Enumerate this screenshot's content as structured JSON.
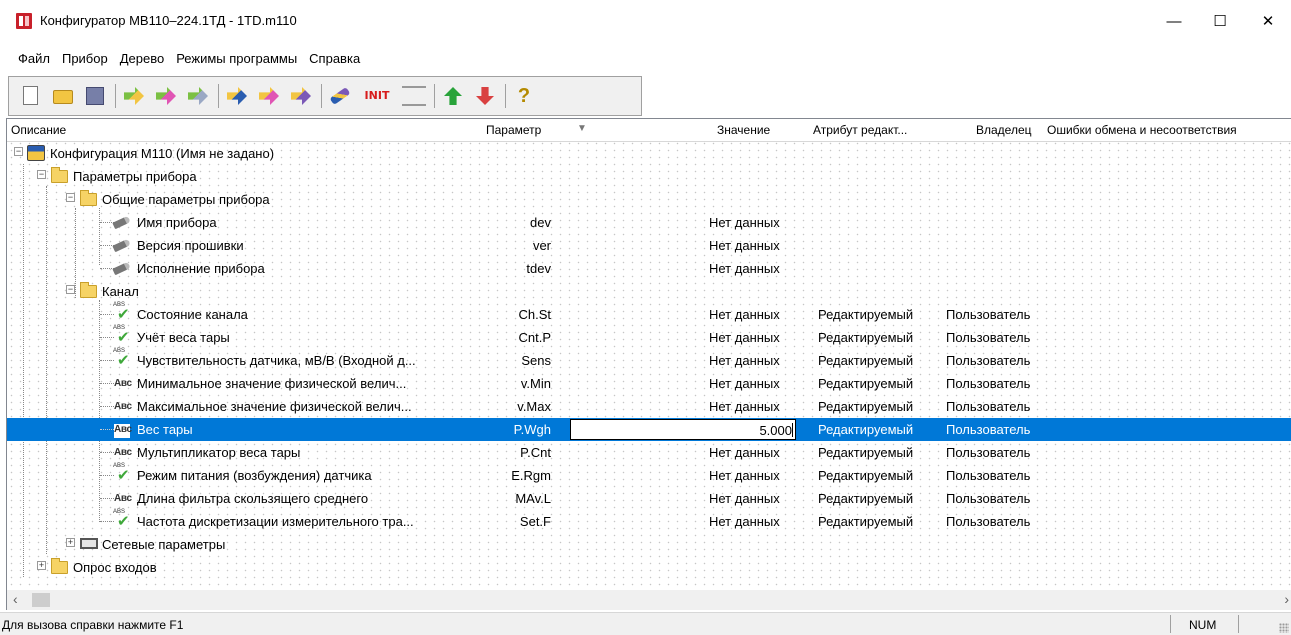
{
  "window": {
    "title": "Конфигуратор МВ110–224.1ТД - 1TD.m110",
    "minimize": "—",
    "maximize": "☐",
    "close": "✕"
  },
  "menu": [
    "Файл",
    "Прибор",
    "Дерево",
    "Режимы программы",
    "Справка"
  ],
  "toolbar": {
    "init_label": "INIT",
    "help_glyph": "?"
  },
  "columns": {
    "description": "Описание",
    "parameter": "Параметр",
    "sort_glyph": "▼",
    "value": "Значение",
    "attribute": "Атрибут редакт...",
    "owner": "Владелец",
    "errors": "Ошибки обмена и несоответствия"
  },
  "tree": {
    "root": "Конфигурация М110 (Имя не задано)",
    "device_params": "Параметры прибора",
    "general_params": "Общие параметры прибора",
    "general_rows": [
      {
        "name": "Имя прибора",
        "param": "dev",
        "value": "Нет данных"
      },
      {
        "name": "Версия прошивки",
        "param": "ver",
        "value": "Нет данных"
      },
      {
        "name": "Исполнение прибора",
        "param": "tdev",
        "value": "Нет данных"
      }
    ],
    "channel": "Канал",
    "channel_rows": [
      {
        "icon": "check",
        "name": "Состояние канала",
        "param": "Ch.St",
        "value": "Нет данных",
        "attr": "Редактируемый",
        "owner": "Пользователь"
      },
      {
        "icon": "check",
        "name": "Учёт веса тары",
        "param": "Cnt.P",
        "value": "Нет данных",
        "attr": "Редактируемый",
        "owner": "Пользователь"
      },
      {
        "icon": "check",
        "name": "Чувствительность датчика, мВ/В (Входной д...",
        "param": "Sens",
        "value": "Нет данных",
        "attr": "Редактируемый",
        "owner": "Пользователь"
      },
      {
        "icon": "abc",
        "name": "Минимальное значение физической велич...",
        "param": "v.Min",
        "value": "Нет данных",
        "attr": "Редактируемый",
        "owner": "Пользователь"
      },
      {
        "icon": "abc",
        "name": "Максимальное значение физической велич...",
        "param": "v.Max",
        "value": "Нет данных",
        "attr": "Редактируемый",
        "owner": "Пользователь"
      },
      {
        "icon": "abc",
        "name": "Вес тары",
        "param": "P.Wgh",
        "value": "5.000",
        "attr": "Редактируемый",
        "owner": "Пользователь"
      },
      {
        "icon": "abc",
        "name": "Мультипликатор веса тары",
        "param": "P.Cnt",
        "value": "Нет данных",
        "attr": "Редактируемый",
        "owner": "Пользователь"
      },
      {
        "icon": "check",
        "name": "Режим питания (возбуждения) датчика",
        "param": "E.Rgm",
        "value": "Нет данных",
        "attr": "Редактируемый",
        "owner": "Пользователь"
      },
      {
        "icon": "abc",
        "name": "Длина фильтра скользящего среднего",
        "param": "MAv.L",
        "value": "Нет данных",
        "attr": "Редактируемый",
        "owner": "Пользователь"
      },
      {
        "icon": "check",
        "name": "Частота дискретизации измерительного тра...",
        "param": "Set.F",
        "value": "Нет данных",
        "attr": "Редактируемый",
        "owner": "Пользователь"
      }
    ],
    "network_params": "Сетевые параметры",
    "inputs_poll": "Опрос входов",
    "abc_glyph": "Авс",
    "check_small": "ABS",
    "check_glyph": "✔"
  },
  "selected_index": 5,
  "status": {
    "message": "Для вызова справки нажмите F1",
    "num": "NUM"
  },
  "colors": {
    "selection": "#0078d7",
    "folder": "#f6d365"
  }
}
